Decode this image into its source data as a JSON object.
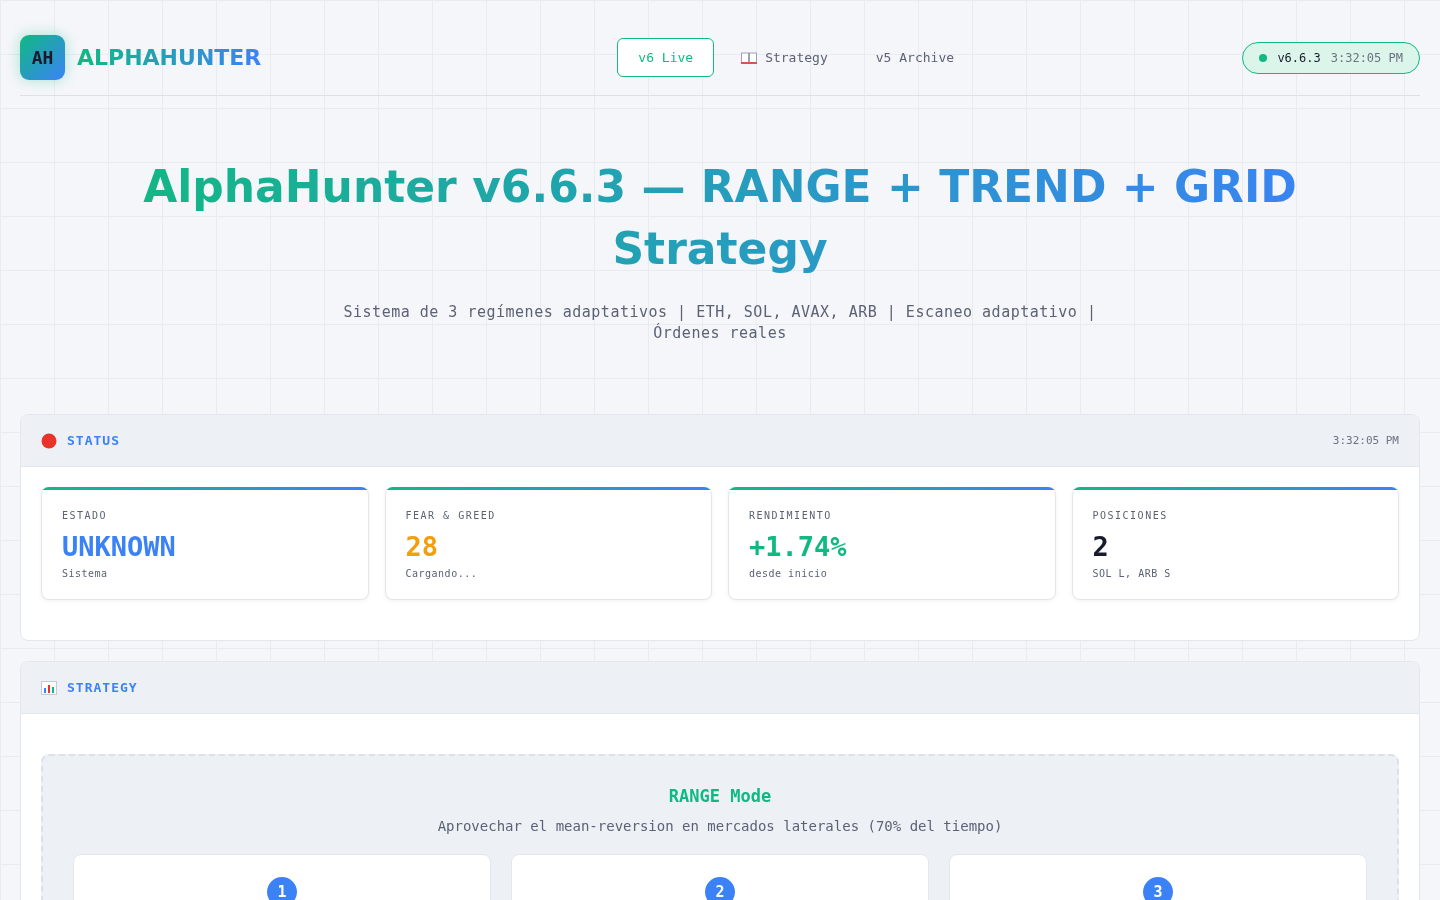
{
  "brand": {
    "logo": "AH",
    "name": "ALPHAHUNTER"
  },
  "nav": [
    {
      "label": "v6 Live",
      "selected": true,
      "icon": false
    },
    {
      "label": "Strategy",
      "selected": false,
      "icon": true
    },
    {
      "label": "v5 Archive",
      "selected": false,
      "icon": false
    }
  ],
  "version_badge": {
    "version": "v6.6.3",
    "time": "3:32:05 PM",
    "online": true
  },
  "hero": {
    "title": "AlphaHunter v6.6.3 — RANGE + TREND + GRID Strategy",
    "subtitle": "Sistema de 3 regímenes adaptativos | ETH, SOL, AVAX, ARB | Escaneo adaptativo | Órdenes reales"
  },
  "status_panel": {
    "title": "STATUS",
    "time": "3:32:05 PM",
    "cards": [
      {
        "label": "ESTADO",
        "value": "UNKNOWN",
        "note": "Sistema",
        "color": "#3b82f6"
      },
      {
        "label": "FEAR & GREED",
        "value": "28",
        "note": "Cargando...",
        "color": "#f59e0b"
      },
      {
        "label": "RENDIMIENTO",
        "value": "+1.74%",
        "note": "desde inicio",
        "color": "#10b981"
      },
      {
        "label": "POSICIONES",
        "value": "2",
        "note": "SOL L, ARB S",
        "color": "#1a1a2e"
      }
    ]
  },
  "strategy_panel": {
    "title": "STRATEGY",
    "mode": {
      "title": "RANGE Mode",
      "description": "Aprovechar el mean-reversion en mercados laterales (70% del tiempo)",
      "steps": [
        "1",
        "2",
        "3"
      ]
    }
  }
}
